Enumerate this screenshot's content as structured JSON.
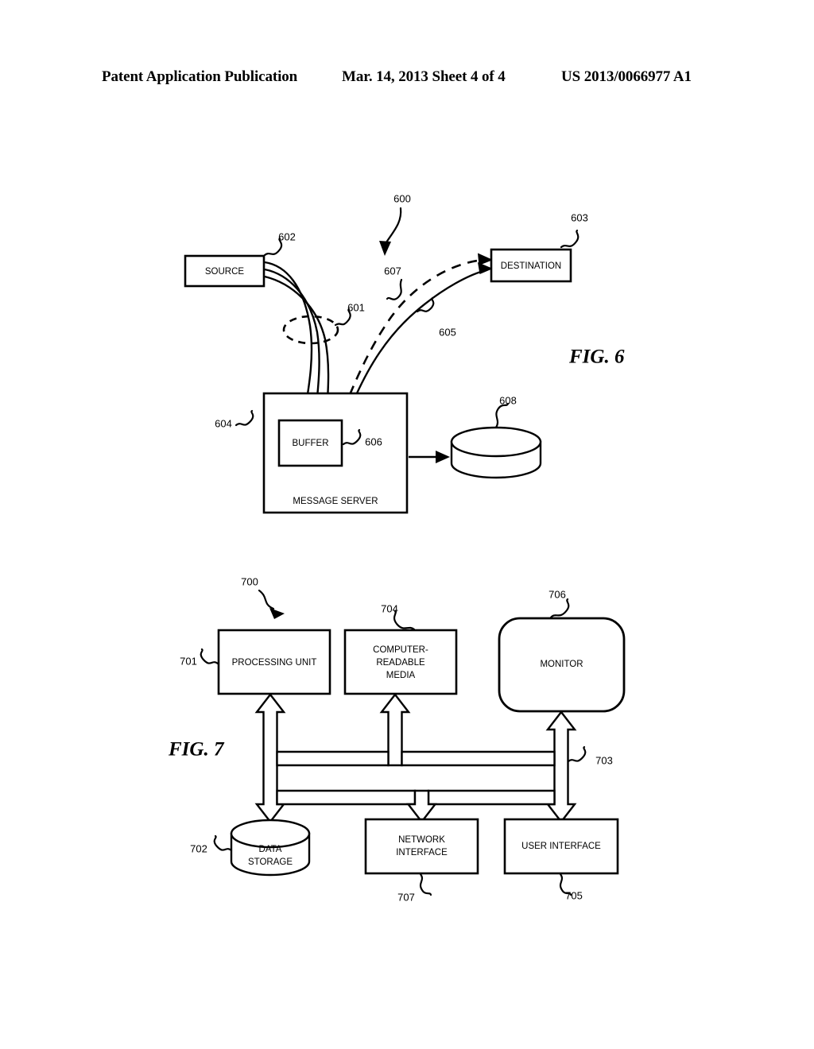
{
  "header": {
    "publication": "Patent Application Publication",
    "date_sheet": "Mar. 14, 2013  Sheet 4 of 4",
    "patent_number": "US 2013/0066977 A1"
  },
  "figures": [
    {
      "id": "fig6",
      "title": "FIG.  6",
      "system_ref": "600",
      "nodes": [
        {
          "name": "source",
          "label": "SOURCE",
          "ref": "602"
        },
        {
          "name": "destination",
          "label": "DESTINATION",
          "ref": "603"
        },
        {
          "name": "message-server",
          "label": "MESSAGE SERVER",
          "ref": "604"
        },
        {
          "name": "buffer",
          "label": "BUFFER",
          "ref": "606"
        },
        {
          "name": "data-store",
          "label": "",
          "ref": "608"
        }
      ],
      "flows": [
        {
          "name": "message-bundle",
          "ref": "601",
          "style": "solid-multi"
        },
        {
          "name": "delivered-message",
          "ref": "605",
          "style": "solid"
        },
        {
          "name": "undelivered-message",
          "ref": "607",
          "style": "dashed"
        }
      ]
    },
    {
      "id": "fig7",
      "title": "FIG. 7",
      "system_ref": "700",
      "nodes": [
        {
          "name": "processing-unit",
          "label": "PROCESSING UNIT",
          "ref": "701"
        },
        {
          "name": "computer-readable-media",
          "label": "COMPUTER-\nREADABLE\nMEDIA",
          "ref": "704",
          "label_lines": [
            "COMPUTER-",
            "READABLE",
            "MEDIA"
          ]
        },
        {
          "name": "monitor",
          "label": "MONITOR",
          "ref": "706"
        },
        {
          "name": "data-storage",
          "label": "DATA\nSTORAGE",
          "ref": "702",
          "label_lines": [
            "DATA",
            "STORAGE"
          ]
        },
        {
          "name": "network-interface",
          "label": "NETWORK\nINTERFACE",
          "ref": "707",
          "label_lines": [
            "NETWORK",
            "INTERFACE"
          ]
        },
        {
          "name": "user-interface",
          "label": "USER INTERFACE",
          "ref": "705"
        }
      ],
      "bus": {
        "name": "system-bus",
        "ref": "703"
      }
    }
  ],
  "colors": {
    "ink": "#000000",
    "paper": "#ffffff"
  }
}
